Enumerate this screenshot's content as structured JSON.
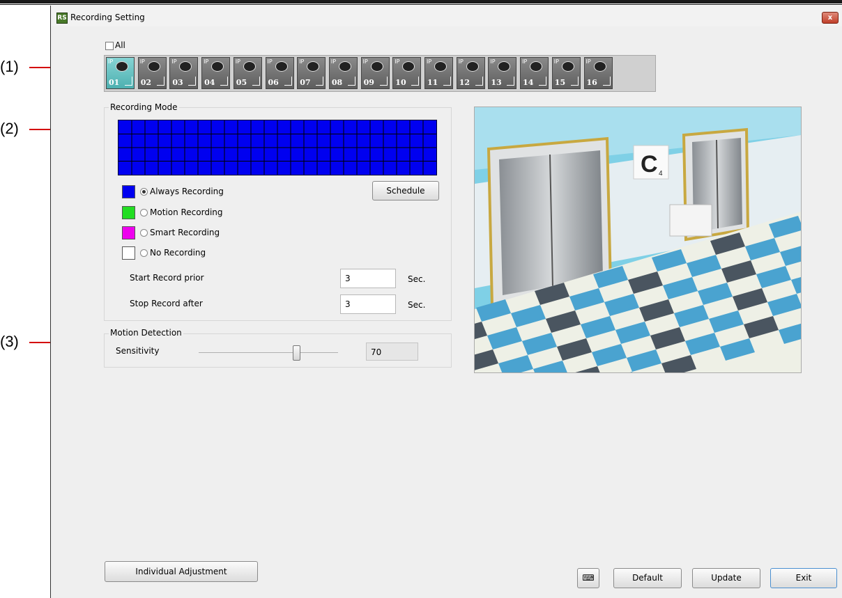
{
  "annotations": [
    "(1)",
    "(2)",
    "(3)"
  ],
  "window": {
    "title": "Recording Setting",
    "close_label": "x"
  },
  "all_checkbox": {
    "label": "All",
    "checked": false
  },
  "cameras": [
    "01",
    "02",
    "03",
    "04",
    "05",
    "06",
    "07",
    "08",
    "09",
    "10",
    "11",
    "12",
    "13",
    "14",
    "15",
    "16"
  ],
  "camera_badge": "IP",
  "selected_camera": "01",
  "recording_mode": {
    "title": "Recording Mode",
    "modes": [
      {
        "label": "Always Recording",
        "color": "#0000f0",
        "selected": true
      },
      {
        "label": "Motion Recording",
        "color": "#22dd22",
        "selected": false
      },
      {
        "label": "Smart Recording",
        "color": "#ee00ee",
        "selected": false
      },
      {
        "label": "No Recording",
        "color": "#ffffff",
        "selected": false
      }
    ],
    "schedule_label": "Schedule",
    "start_prior": {
      "label": "Start Record prior",
      "value": "3",
      "unit": "Sec."
    },
    "stop_after": {
      "label": "Stop Record after",
      "value": "3",
      "unit": "Sec."
    }
  },
  "motion_detection": {
    "title": "Motion Detection",
    "sensitivity_label": "Sensitivity",
    "sensitivity_value": "70",
    "sensitivity_level": 0.7
  },
  "preview_sign": "C",
  "preview_sign_sub": "4",
  "buttons": {
    "individual": "Individual Adjustment",
    "keyboard_icon": "keyboard-icon",
    "default": "Default",
    "update": "Update",
    "exit": "Exit"
  }
}
